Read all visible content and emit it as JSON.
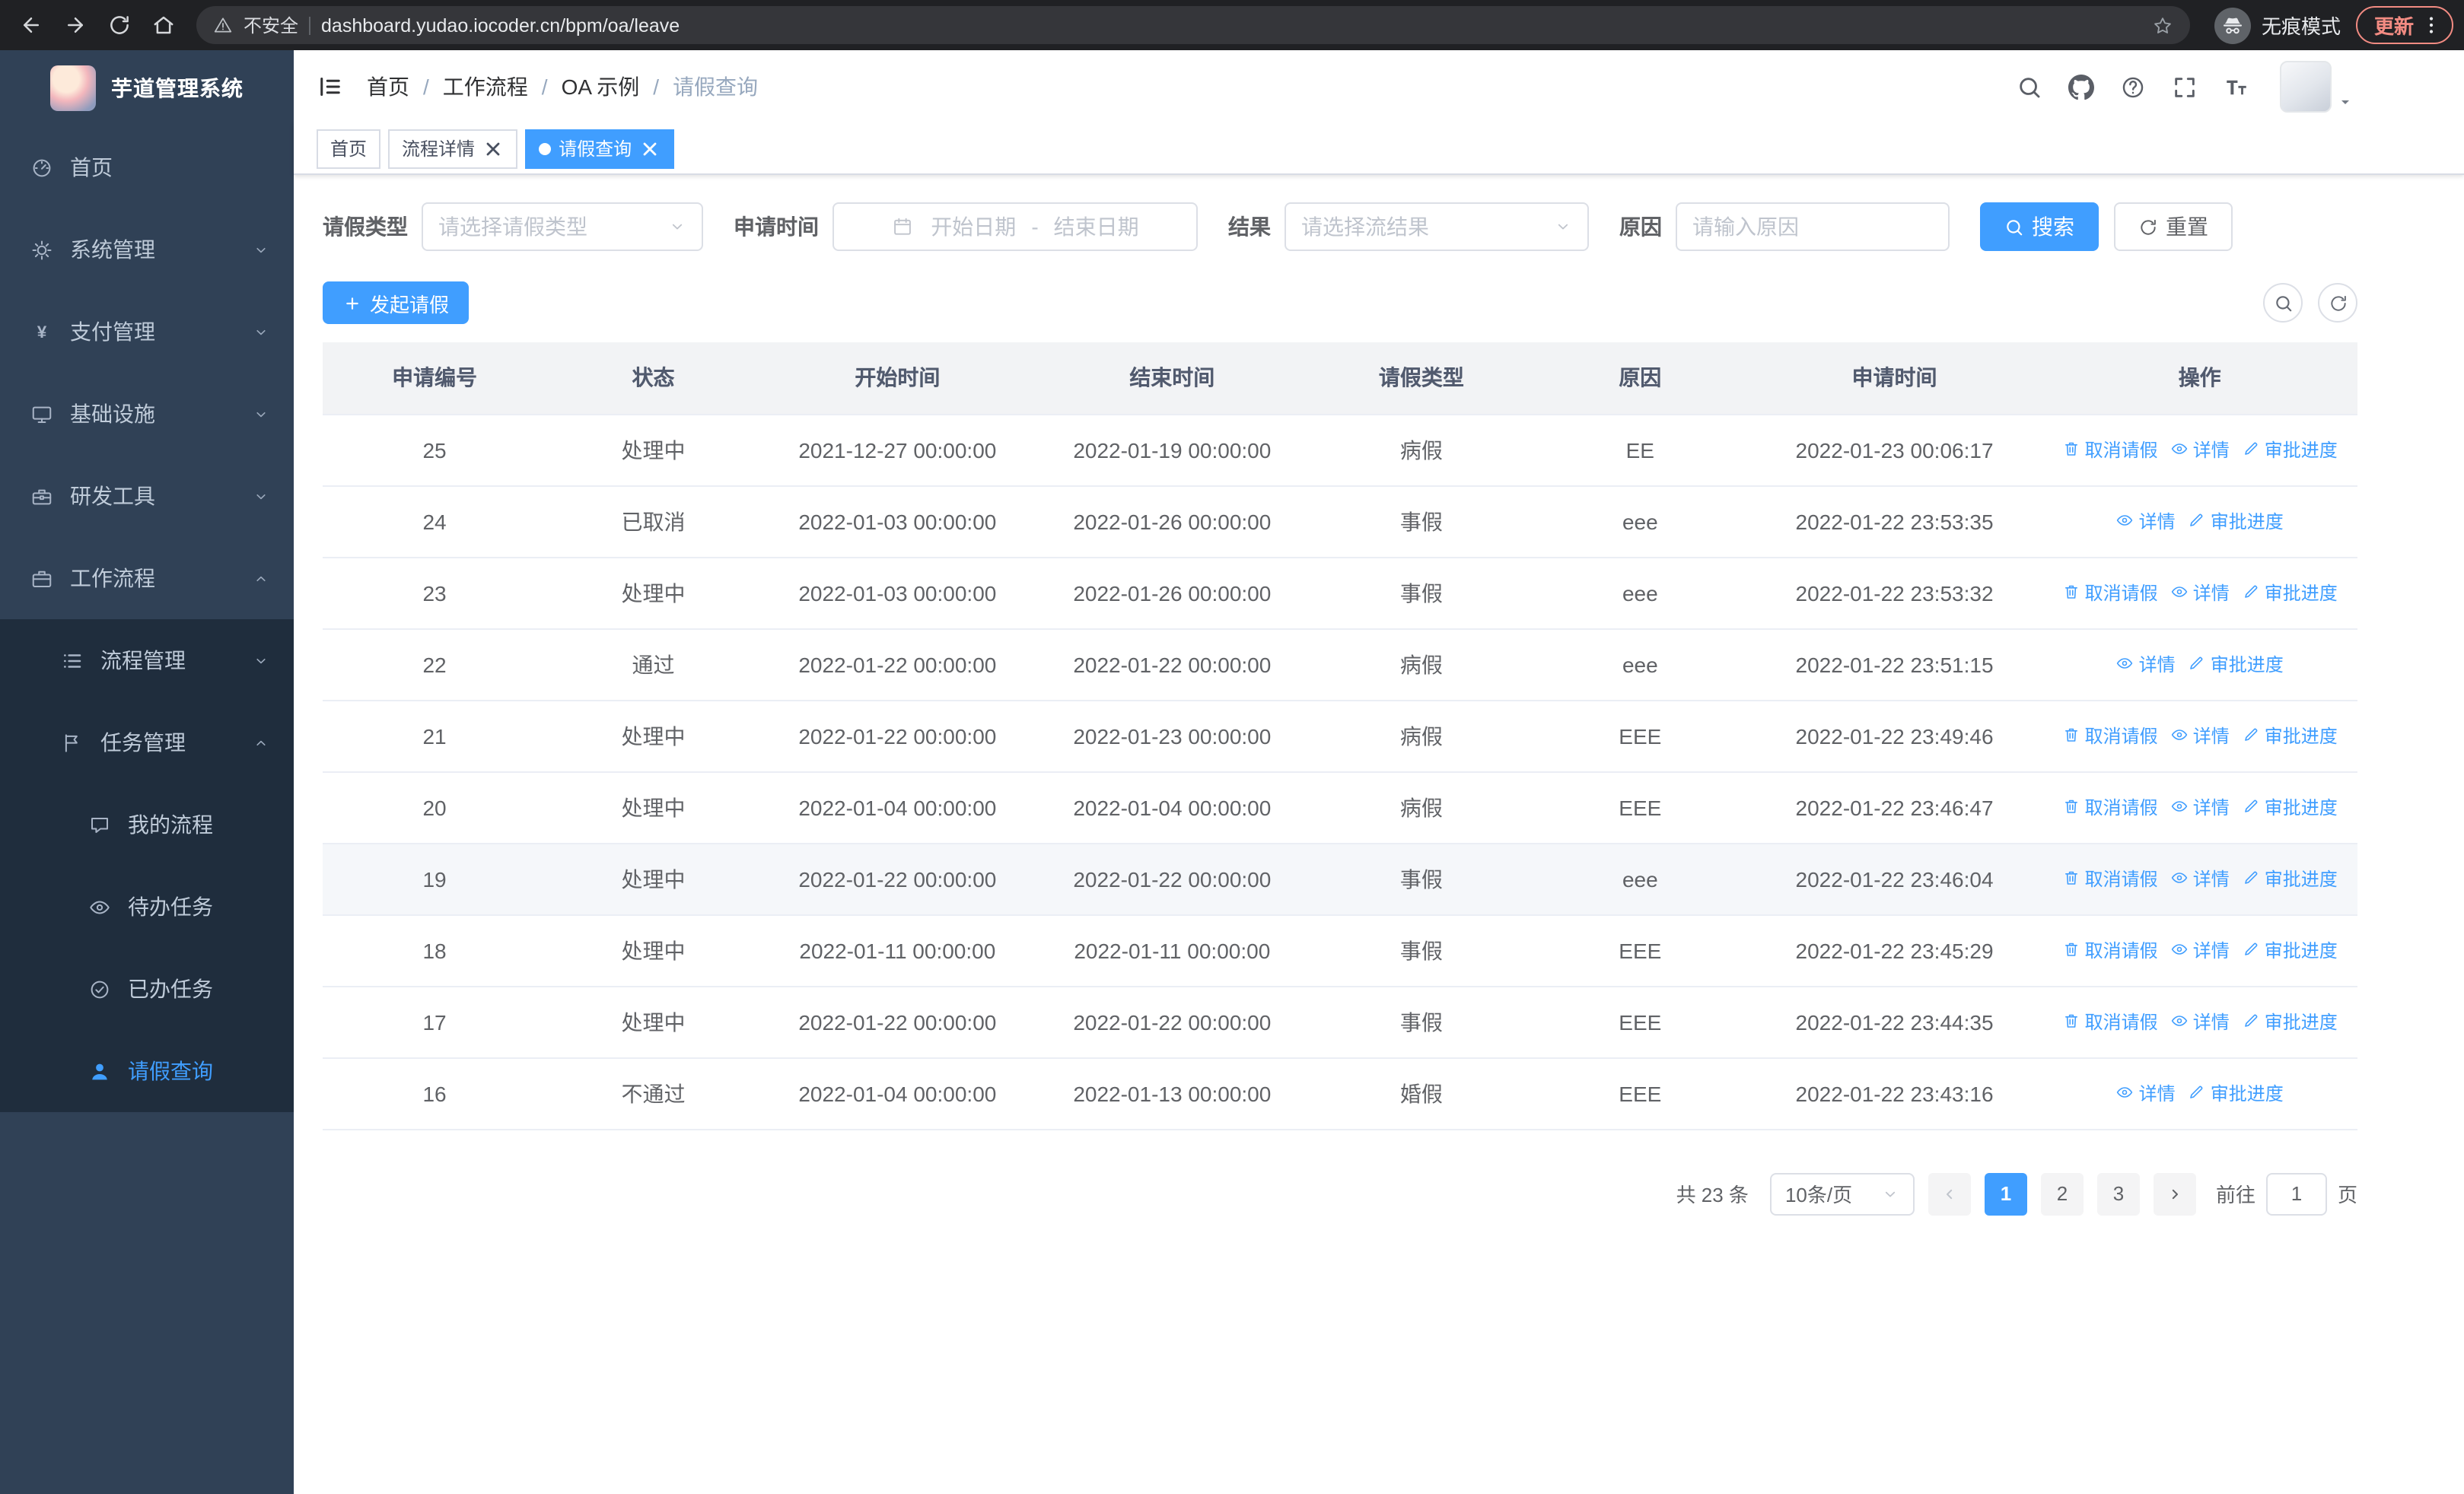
{
  "theme": {
    "primary": "#409eff",
    "sidebar_bg": "#304156",
    "submenu_bg": "#1f2d3d",
    "sidebar_text": "#bfcbd9"
  },
  "browser": {
    "security_label": "不安全",
    "url": "dashboard.yudao.iocoder.cn/bpm/oa/leave",
    "incognito_label": "无痕模式",
    "update_label": "更新"
  },
  "app": {
    "logo_title": "芋道管理系统"
  },
  "sidebar": {
    "items": [
      {
        "key": "home",
        "icon": "dashboard",
        "label": "首页",
        "level": 1
      },
      {
        "key": "system",
        "icon": "gear",
        "label": "系统管理",
        "level": 1,
        "chevron": "down"
      },
      {
        "key": "payment",
        "icon": "yen",
        "label": "支付管理",
        "level": 1,
        "chevron": "down"
      },
      {
        "key": "infrastructure",
        "icon": "monitor",
        "label": "基础设施",
        "level": 1,
        "chevron": "down"
      },
      {
        "key": "devtools",
        "icon": "toolbox",
        "label": "研发工具",
        "level": 1,
        "chevron": "down"
      },
      {
        "key": "workflow",
        "icon": "briefcase",
        "label": "工作流程",
        "level": 1,
        "chevron": "up"
      },
      {
        "key": "process-mgmt",
        "icon": "list",
        "label": "流程管理",
        "level": 2,
        "chevron": "down",
        "submenu": true
      },
      {
        "key": "task-mgmt",
        "icon": "flag",
        "label": "任务管理",
        "level": 2,
        "chevron": "up",
        "submenu": true
      },
      {
        "key": "my-process",
        "icon": "chat",
        "label": "我的流程",
        "level": 3,
        "submenu": true
      },
      {
        "key": "todo-tasks",
        "icon": "eye",
        "label": "待办任务",
        "level": 3,
        "submenu": true
      },
      {
        "key": "done-tasks",
        "icon": "check",
        "label": "已办任务",
        "level": 3,
        "submenu": true
      },
      {
        "key": "leave-query",
        "icon": "user",
        "label": "请假查询",
        "level": 3,
        "submenu": true,
        "active": true
      }
    ]
  },
  "breadcrumb": {
    "separator": "/",
    "items": [
      "首页",
      "工作流程",
      "OA 示例",
      "请假查询"
    ]
  },
  "tabs": [
    {
      "key": "home",
      "label": "首页",
      "closable": false,
      "active": false
    },
    {
      "key": "process-detail",
      "label": "流程详情",
      "closable": true,
      "active": false
    },
    {
      "key": "leave-query",
      "label": "请假查询",
      "closable": true,
      "active": true
    }
  ],
  "filters": {
    "leave_type_label": "请假类型",
    "leave_type_placeholder": "请选择请假类型",
    "apply_time_label": "申请时间",
    "start_date_placeholder": "开始日期",
    "range_separator": "-",
    "end_date_placeholder": "结束日期",
    "result_label": "结果",
    "result_placeholder": "请选择流结果",
    "reason_label": "原因",
    "reason_placeholder": "请输入原因",
    "search_label": "搜索",
    "reset_label": "重置"
  },
  "toolbar": {
    "create_label": "发起请假"
  },
  "table": {
    "columns": [
      "申请编号",
      "状态",
      "开始时间",
      "结束时间",
      "请假类型",
      "原因",
      "申请时间",
      "操作"
    ],
    "action_labels": {
      "cancel": "取消请假",
      "detail": "详情",
      "progress": "审批进度"
    },
    "rows": [
      {
        "id": "25",
        "status": "处理中",
        "start": "2021-12-27 00:00:00",
        "end": "2022-01-19 00:00:00",
        "type": "病假",
        "reason": "EE",
        "applied": "2022-01-23 00:06:17",
        "cancellable": true
      },
      {
        "id": "24",
        "status": "已取消",
        "start": "2022-01-03 00:00:00",
        "end": "2022-01-26 00:00:00",
        "type": "事假",
        "reason": "eee",
        "applied": "2022-01-22 23:53:35",
        "cancellable": false
      },
      {
        "id": "23",
        "status": "处理中",
        "start": "2022-01-03 00:00:00",
        "end": "2022-01-26 00:00:00",
        "type": "事假",
        "reason": "eee",
        "applied": "2022-01-22 23:53:32",
        "cancellable": true
      },
      {
        "id": "22",
        "status": "通过",
        "start": "2022-01-22 00:00:00",
        "end": "2022-01-22 00:00:00",
        "type": "病假",
        "reason": "eee",
        "applied": "2022-01-22 23:51:15",
        "cancellable": false
      },
      {
        "id": "21",
        "status": "处理中",
        "start": "2022-01-22 00:00:00",
        "end": "2022-01-23 00:00:00",
        "type": "病假",
        "reason": "EEE",
        "applied": "2022-01-22 23:49:46",
        "cancellable": true
      },
      {
        "id": "20",
        "status": "处理中",
        "start": "2022-01-04 00:00:00",
        "end": "2022-01-04 00:00:00",
        "type": "病假",
        "reason": "EEE",
        "applied": "2022-01-22 23:46:47",
        "cancellable": true
      },
      {
        "id": "19",
        "status": "处理中",
        "start": "2022-01-22 00:00:00",
        "end": "2022-01-22 00:00:00",
        "type": "事假",
        "reason": "eee",
        "applied": "2022-01-22 23:46:04",
        "cancellable": true,
        "highlighted": true
      },
      {
        "id": "18",
        "status": "处理中",
        "start": "2022-01-11 00:00:00",
        "end": "2022-01-11 00:00:00",
        "type": "事假",
        "reason": "EEE",
        "applied": "2022-01-22 23:45:29",
        "cancellable": true
      },
      {
        "id": "17",
        "status": "处理中",
        "start": "2022-01-22 00:00:00",
        "end": "2022-01-22 00:00:00",
        "type": "事假",
        "reason": "EEE",
        "applied": "2022-01-22 23:44:35",
        "cancellable": true
      },
      {
        "id": "16",
        "status": "不通过",
        "start": "2022-01-04 00:00:00",
        "end": "2022-01-13 00:00:00",
        "type": "婚假",
        "reason": "EEE",
        "applied": "2022-01-22 23:43:16",
        "cancellable": false
      }
    ]
  },
  "pagination": {
    "total_label": "共 23 条",
    "page_size_label": "10条/页",
    "pages": [
      "1",
      "2",
      "3"
    ],
    "active_page": "1",
    "goto_prefix": "前往",
    "goto_value": "1",
    "goto_suffix": "页"
  }
}
